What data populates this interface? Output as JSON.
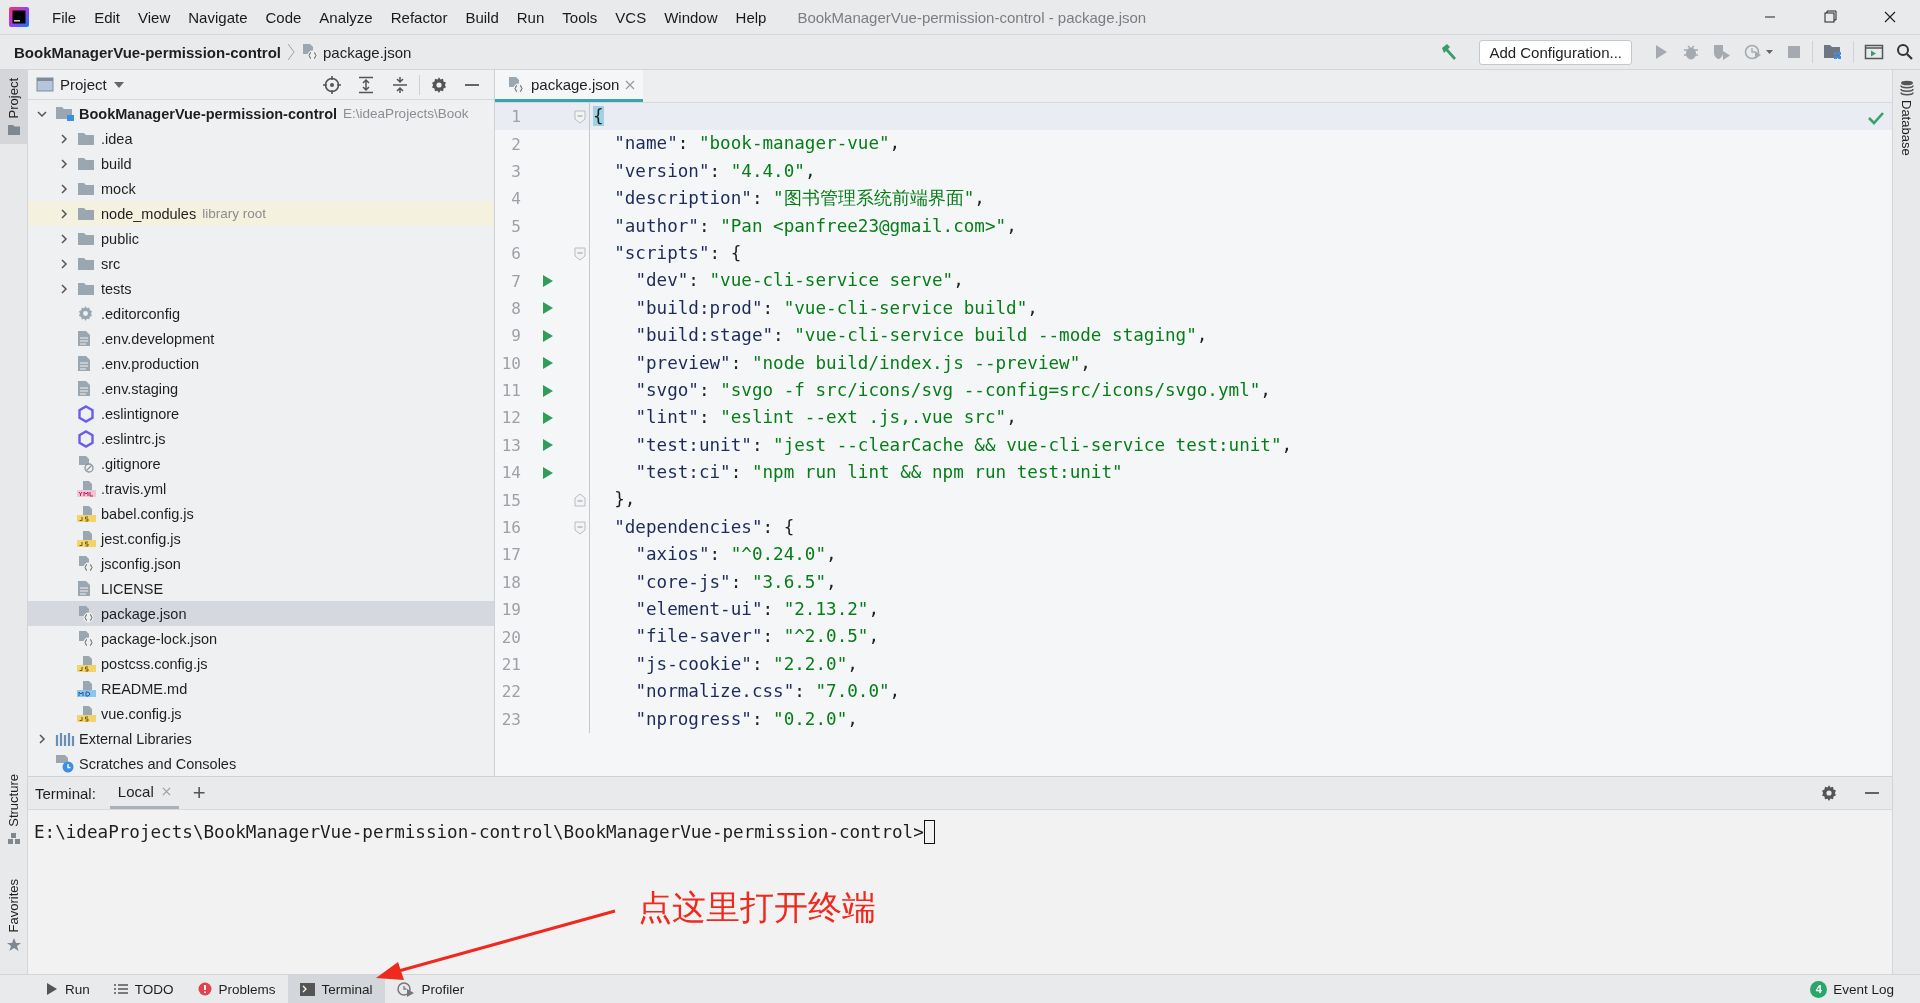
{
  "title_bar": {
    "menu": [
      "File",
      "Edit",
      "View",
      "Navigate",
      "Code",
      "Analyze",
      "Refactor",
      "Build",
      "Run",
      "Tools",
      "VCS",
      "Window",
      "Help"
    ],
    "title": "BookManagerVue-permission-control - package.json"
  },
  "nav_bar": {
    "breadcrumbs": [
      {
        "label": "BookManagerVue-permission-control",
        "kind": "project"
      },
      {
        "label": "package.json",
        "kind": "json"
      }
    ],
    "run_config": "Add Configuration..."
  },
  "side_tabs": {
    "left_top": [
      {
        "label": "Project",
        "selected": true
      }
    ],
    "left_bottom": [
      {
        "label": "Structure",
        "selected": false
      },
      {
        "label": "Favorites",
        "selected": false
      }
    ],
    "right": [
      {
        "label": "Database",
        "selected": false
      }
    ]
  },
  "project_panel": {
    "title": "Project",
    "tree": [
      {
        "label": "BookManagerVue-permission-control",
        "path": "E:\\ideaProjects\\Book",
        "kind": "module",
        "expanded": true,
        "selected": false,
        "children": [
          {
            "label": ".idea",
            "kind": "folder",
            "expanded": false,
            "selected": false
          },
          {
            "label": "build",
            "kind": "folder",
            "expanded": false,
            "selected": false
          },
          {
            "label": "mock",
            "kind": "folder",
            "expanded": false,
            "selected": false
          },
          {
            "label": "node_modules",
            "note": "library root",
            "kind": "folder",
            "expanded": false,
            "selected": false
          },
          {
            "label": "public",
            "kind": "folder",
            "expanded": false,
            "selected": false
          },
          {
            "label": "src",
            "kind": "folder",
            "expanded": false,
            "selected": false
          },
          {
            "label": "tests",
            "kind": "folder",
            "expanded": false,
            "selected": false
          },
          {
            "label": ".editorconfig",
            "kind": "config",
            "selected": false
          },
          {
            "label": ".env.development",
            "kind": "text",
            "selected": false
          },
          {
            "label": ".env.production",
            "kind": "text",
            "selected": false
          },
          {
            "label": ".env.staging",
            "kind": "text",
            "selected": false
          },
          {
            "label": ".eslintignore",
            "kind": "eslint",
            "selected": false
          },
          {
            "label": ".eslintrc.js",
            "kind": "eslint",
            "selected": false
          },
          {
            "label": ".gitignore",
            "kind": "ignore",
            "selected": false
          },
          {
            "label": ".travis.yml",
            "kind": "yml",
            "selected": false
          },
          {
            "label": "babel.config.js",
            "kind": "js",
            "selected": false
          },
          {
            "label": "jest.config.js",
            "kind": "js",
            "selected": false
          },
          {
            "label": "jsconfig.json",
            "kind": "json",
            "selected": false
          },
          {
            "label": "LICENSE",
            "kind": "text",
            "selected": false
          },
          {
            "label": "package.json",
            "kind": "json",
            "selected": true
          },
          {
            "label": "package-lock.json",
            "kind": "json",
            "selected": false
          },
          {
            "label": "postcss.config.js",
            "kind": "js",
            "selected": false
          },
          {
            "label": "README.md",
            "kind": "md",
            "selected": false
          },
          {
            "label": "vue.config.js",
            "kind": "js",
            "selected": false
          }
        ]
      },
      {
        "label": "External Libraries",
        "kind": "libraries",
        "expanded": false,
        "selected": false
      },
      {
        "label": "Scratches and Consoles",
        "kind": "scratches",
        "selected": false
      }
    ]
  },
  "editor": {
    "tabs": [
      {
        "label": "package.json",
        "selected": true
      }
    ],
    "inspection_ok": true,
    "lines": [
      {
        "number": "1",
        "text": "{",
        "run": false,
        "fold_start": true,
        "current": true
      },
      {
        "number": "2",
        "text": "  \"name\": \"book-manager-vue\",",
        "run": false,
        "current": false
      },
      {
        "number": "3",
        "text": "  \"version\": \"4.4.0\",",
        "run": false,
        "current": false
      },
      {
        "number": "4",
        "text": "  \"description\": \"图书管理系统前端界面\",",
        "run": false,
        "current": false
      },
      {
        "number": "5",
        "text": "  \"author\": \"Pan <panfree23@gmail.com>\",",
        "run": false,
        "current": false
      },
      {
        "number": "6",
        "text": "  \"scripts\": {",
        "run": false,
        "fold_start": true,
        "current": false
      },
      {
        "number": "7",
        "text": "    \"dev\": \"vue-cli-service serve\",",
        "run": true,
        "current": false
      },
      {
        "number": "8",
        "text": "    \"build:prod\": \"vue-cli-service build\",",
        "run": true,
        "current": false
      },
      {
        "number": "9",
        "text": "    \"build:stage\": \"vue-cli-service build --mode staging\",",
        "run": true,
        "current": false
      },
      {
        "number": "10",
        "text": "    \"preview\": \"node build/index.js --preview\",",
        "run": true,
        "current": false
      },
      {
        "number": "11",
        "text": "    \"svgo\": \"svgo -f src/icons/svg --config=src/icons/svgo.yml\",",
        "run": true,
        "current": false
      },
      {
        "number": "12",
        "text": "    \"lint\": \"eslint --ext .js,.vue src\",",
        "run": true,
        "current": false
      },
      {
        "number": "13",
        "text": "    \"test:unit\": \"jest --clearCache && vue-cli-service test:unit\",",
        "run": true,
        "current": false
      },
      {
        "number": "14",
        "text": "    \"test:ci\": \"npm run lint && npm run test:unit\"",
        "run": true,
        "current": false
      },
      {
        "number": "15",
        "text": "  },",
        "run": false,
        "fold_end": true,
        "current": false
      },
      {
        "number": "16",
        "text": "  \"dependencies\": {",
        "run": false,
        "fold_start": true,
        "current": false
      },
      {
        "number": "17",
        "text": "    \"axios\": \"^0.24.0\",",
        "run": false,
        "current": false
      },
      {
        "number": "18",
        "text": "    \"core-js\": \"3.6.5\",",
        "run": false,
        "current": false
      },
      {
        "number": "19",
        "text": "    \"element-ui\": \"2.13.2\",",
        "run": false,
        "current": false
      },
      {
        "number": "20",
        "text": "    \"file-saver\": \"^2.0.5\",",
        "run": false,
        "current": false
      },
      {
        "number": "21",
        "text": "    \"js-cookie\": \"2.2.0\",",
        "run": false,
        "current": false
      },
      {
        "number": "22",
        "text": "    \"normalize.css\": \"7.0.0\",",
        "run": false,
        "current": false
      },
      {
        "number": "23",
        "text": "    \"nprogress\": \"0.2.0\",",
        "run": false,
        "current": false
      }
    ]
  },
  "terminal": {
    "label": "Terminal:",
    "tabs": [
      {
        "label": "Local",
        "selected": true
      }
    ],
    "new_tab": "+",
    "prompt": "E:\\ideaProjects\\BookManagerVue-permission-control\\BookManagerVue-permission-control>"
  },
  "annotation": {
    "text": "点这里打开终端"
  },
  "status_bar": {
    "tools": [
      {
        "label": "Run",
        "kind": "run",
        "selected": false
      },
      {
        "label": "TODO",
        "kind": "todo",
        "selected": false
      },
      {
        "label": "Problems",
        "kind": "problems",
        "selected": false
      },
      {
        "label": "Terminal",
        "kind": "terminal",
        "selected": true
      },
      {
        "label": "Profiler",
        "kind": "profiler",
        "selected": false
      }
    ],
    "event_log": {
      "label": "Event Log",
      "count": "4"
    }
  }
}
